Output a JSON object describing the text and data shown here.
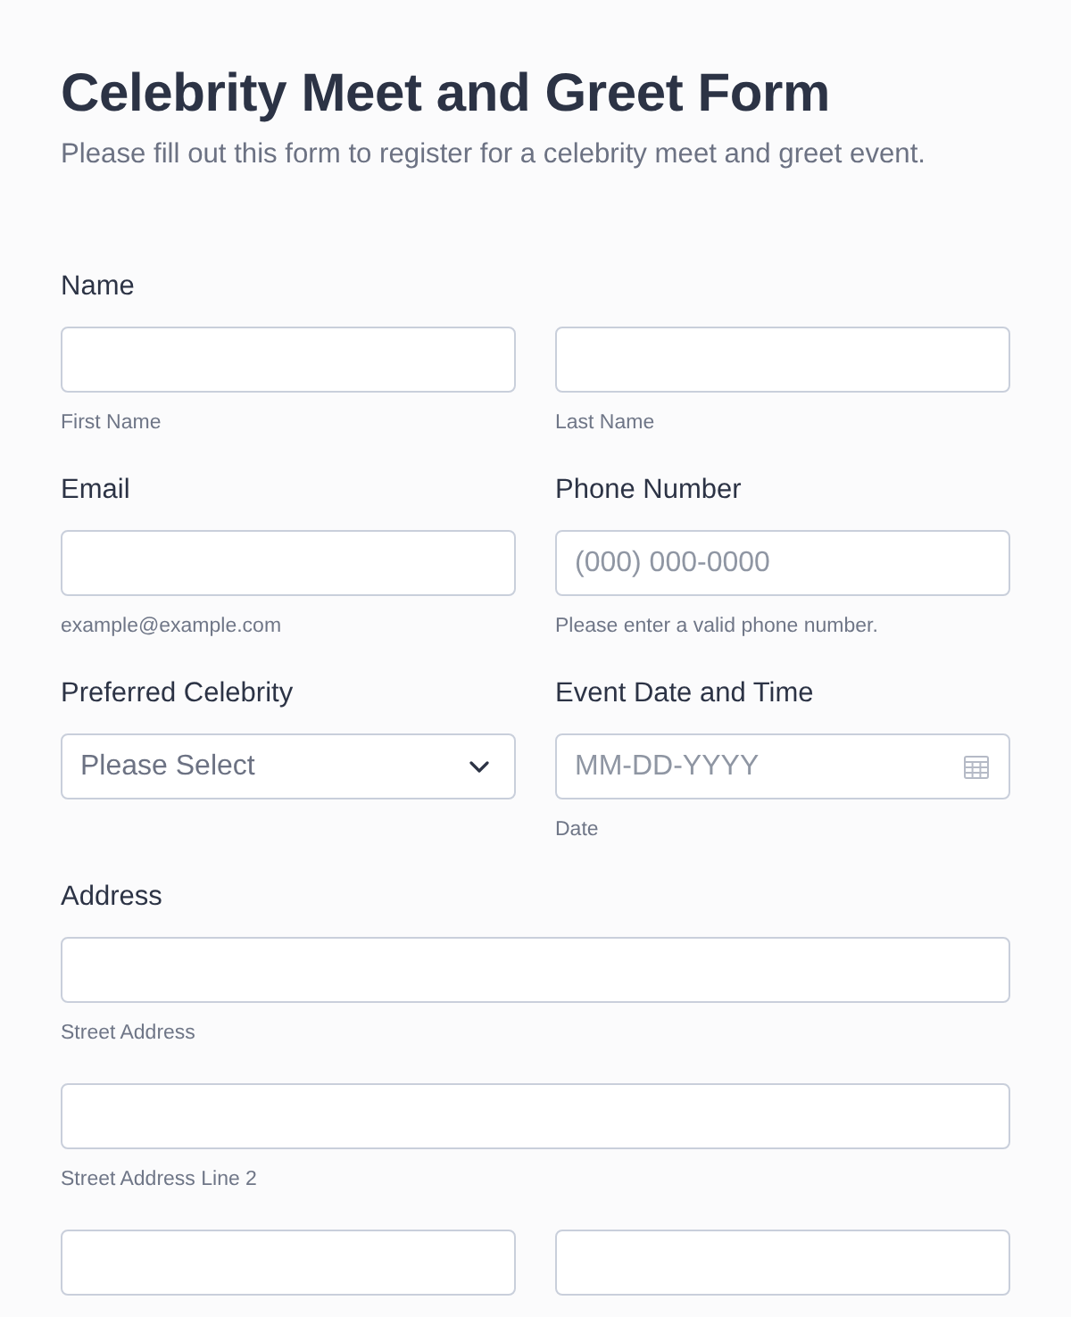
{
  "form": {
    "title": "Celebrity Meet and Greet Form",
    "description": "Please fill out this form to register for a celebrity meet and greet event."
  },
  "rows": [
    {
      "fields": [
        {
          "label": "Name",
          "input_rows": [
            [
              {
                "kind": "text",
                "sublabel": "First Name"
              },
              {
                "kind": "text",
                "sublabel": "Last Name"
              }
            ]
          ]
        }
      ]
    },
    {
      "fields": [
        {
          "label": "Email",
          "input_rows": [
            [
              {
                "kind": "text",
                "sublabel": "example@example.com"
              }
            ]
          ]
        },
        {
          "label": "Phone Number",
          "input_rows": [
            [
              {
                "kind": "text",
                "placeholder": "(000) 000-0000",
                "sublabel": "Please enter a valid phone number."
              }
            ]
          ]
        }
      ]
    },
    {
      "fields": [
        {
          "label": "Preferred Celebrity",
          "input_rows": [
            [
              {
                "kind": "select",
                "placeholder": "Please Select"
              }
            ]
          ]
        },
        {
          "label": "Event Date and Time",
          "input_rows": [
            [
              {
                "kind": "date",
                "placeholder": "MM-DD-YYYY",
                "sublabel": "Date"
              }
            ]
          ]
        }
      ]
    },
    {
      "fields": [
        {
          "label": "Address",
          "input_rows": [
            [
              {
                "kind": "text",
                "sublabel": "Street Address"
              }
            ],
            [
              {
                "kind": "text",
                "sublabel": "Street Address Line 2"
              }
            ],
            [
              {
                "kind": "text"
              },
              {
                "kind": "text"
              }
            ]
          ]
        }
      ]
    }
  ]
}
